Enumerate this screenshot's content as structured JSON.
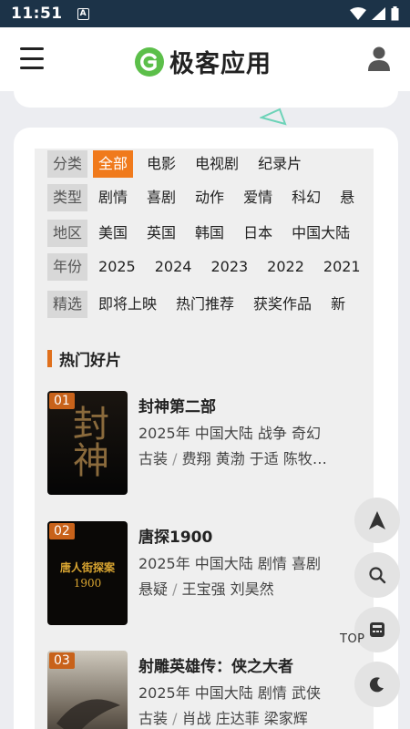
{
  "status_bar": {
    "time": "11:51",
    "badge": "A"
  },
  "header": {
    "title": "极客应用"
  },
  "filters": [
    {
      "label": "分类",
      "options": [
        "全部",
        "电影",
        "电视剧",
        "纪录片"
      ],
      "active": 0
    },
    {
      "label": "类型",
      "options": [
        "剧情",
        "喜剧",
        "动作",
        "爱情",
        "科幻",
        "悬"
      ]
    },
    {
      "label": "地区",
      "options": [
        "美国",
        "英国",
        "韩国",
        "日本",
        "中国大陆"
      ]
    },
    {
      "label": "年份",
      "options": [
        "2025",
        "2024",
        "2023",
        "2022",
        "2021"
      ]
    },
    {
      "label": "精选",
      "options": [
        "即将上映",
        "热门推荐",
        "获奖作品",
        "新"
      ]
    }
  ],
  "section": {
    "title": "热门好片"
  },
  "movies": [
    {
      "rank": "01",
      "title": "封神第二部",
      "meta": "2025年 中国大陆 战争 奇幻",
      "genre": "古装",
      "sep": "/",
      "cast": "费翔 黄渤 于适 陈牧…",
      "poster_text": "封神"
    },
    {
      "rank": "02",
      "title": "唐探1900",
      "meta": "2025年 中国大陆 剧情 喜剧",
      "genre": "悬疑",
      "sep": "/",
      "cast": "王宝强 刘昊然",
      "poster_text": "唐人街探案",
      "poster_sub": "1900"
    },
    {
      "rank": "03",
      "title": "射雕英雄传：侠之大者",
      "meta": "2025年 中国大陆 剧情 武侠",
      "genre": "古装",
      "sep": "/",
      "cast": "肖战 庄达菲 梁家辉"
    }
  ],
  "floating": {
    "top_label": "TOP"
  },
  "colors": {
    "accent": "#f07a1c",
    "status_bar": "#1c3348",
    "logo_green": "#5cbf4a"
  }
}
